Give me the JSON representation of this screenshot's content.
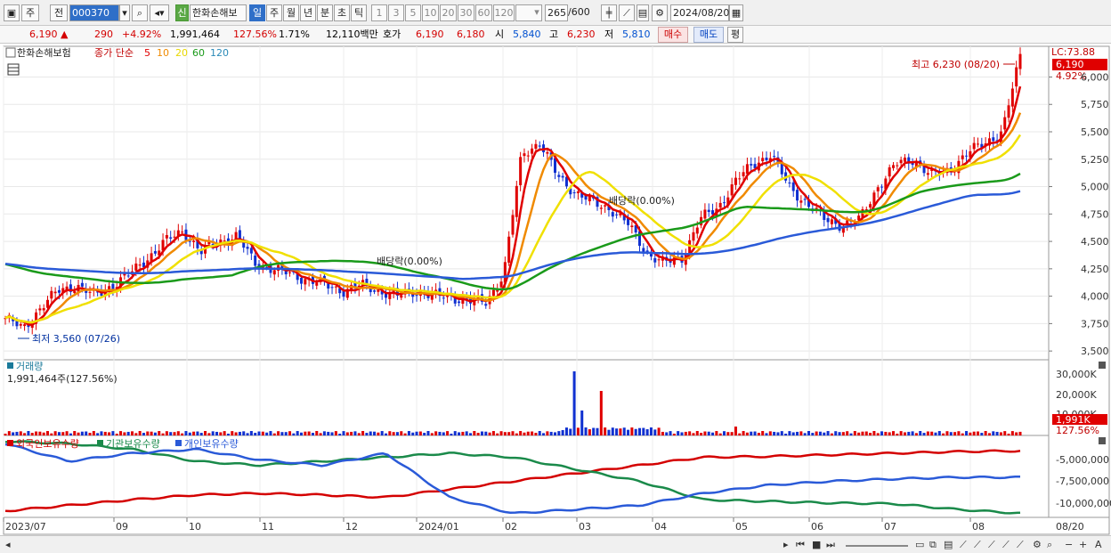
{
  "toolbar": {
    "period_unit": "주",
    "prev": "전",
    "code": "000370",
    "credit_badge": "신",
    "stock_name": "한화손해보",
    "periods": [
      "일",
      "주",
      "월",
      "년",
      "분",
      "초",
      "틱"
    ],
    "ticks": [
      "1",
      "3",
      "5",
      "10",
      "20",
      "30",
      "60",
      "120"
    ],
    "count_value": "265",
    "count_max": "/600",
    "date": "2024/08/20"
  },
  "quote": {
    "price": "6,190",
    "up_arrow": "▲",
    "change": "290",
    "change_rate": "+4.92%",
    "volume": "1,991,464",
    "volume_rate": "127.56%",
    "turnover": "1.71%",
    "amount": "12,110백만",
    "bid_label": "호가",
    "ask_price": "6,190",
    "bid_price": "6,180",
    "open_label": "시",
    "open": "5,840",
    "high_label": "고",
    "high": "6,230",
    "low_label": "저",
    "low": "5,810",
    "buy_button": "매수",
    "sell_button": "매도",
    "eval_button": "평"
  },
  "price_panel": {
    "legend_name": "한화손해보험",
    "legend_type": "종가 단순",
    "ma_labels": [
      "5",
      "10",
      "20",
      "60",
      "120"
    ],
    "ma_colors": [
      "#e00000",
      "#f08a00",
      "#f0e000",
      "#1a9a1a",
      "#2a5ad8"
    ],
    "lc_label": "LC:73.88",
    "current_price_tag": "6,190",
    "current_rate_tag": "4.92%",
    "high_annotation": "최고 6,230 (08/20)",
    "low_annotation": "최저 3,560 (07/26)",
    "dividend_annotation_1": "배당락(0.00%)",
    "dividend_annotation_2": "배당락(0.00%)",
    "y_ticks": [
      "6,000",
      "5,750",
      "5,500",
      "5,250",
      "5,000",
      "4,750",
      "4,500",
      "4,250",
      "4,000",
      "3,750",
      "3,500"
    ]
  },
  "volume_panel": {
    "title": "거래량",
    "value": "1,991,464주(127.56%)",
    "y_ticks": [
      "30,000K",
      "20,000K",
      "10,000K"
    ],
    "current_tag": "1,991K",
    "current_rate_tag": "127.56%"
  },
  "holding_panel": {
    "series_labels": [
      "외국인보유수량",
      "기관보유수량",
      "개인보유수량"
    ],
    "series_colors": [
      "#d40000",
      "#1a8a4a",
      "#2a5ad8"
    ],
    "y_ticks": [
      "-5,000,000",
      "-7,500,000",
      "-10,000,000"
    ]
  },
  "x_axis": {
    "labels": [
      "2023/07",
      "09",
      "10",
      "11",
      "12",
      "2024/01",
      "02",
      "03",
      "04",
      "05",
      "06",
      "07",
      "08"
    ],
    "end_label": "08/20"
  },
  "chart_data": {
    "type": "line",
    "title": "한화손해보험",
    "series": [
      {
        "name": "종가",
        "values": [
          3800,
          3700,
          3900,
          4050,
          4100,
          4000,
          4100,
          4200,
          4350,
          4500,
          4600,
          4400,
          4500,
          4550,
          4300,
          4250,
          4200,
          4150,
          4100,
          4050,
          4100,
          4050,
          4000,
          4050,
          4000,
          4000,
          3950,
          3950,
          4200,
          5300,
          5400,
          5100,
          4950,
          4850,
          4800,
          4650,
          4400,
          4300,
          4350,
          4700,
          4800,
          5050,
          5200,
          5300,
          5000,
          4850,
          4700,
          4650,
          4700,
          5000,
          5200,
          5250,
          5100,
          5150,
          5300,
          5400,
          5500,
          6190
        ]
      }
    ],
    "x": [
      "2023/07",
      "09",
      "10",
      "11",
      "12",
      "2024/01",
      "02",
      "03",
      "04",
      "05",
      "06",
      "07",
      "08",
      "08/20"
    ],
    "ylim": [
      3500,
      6200
    ]
  }
}
